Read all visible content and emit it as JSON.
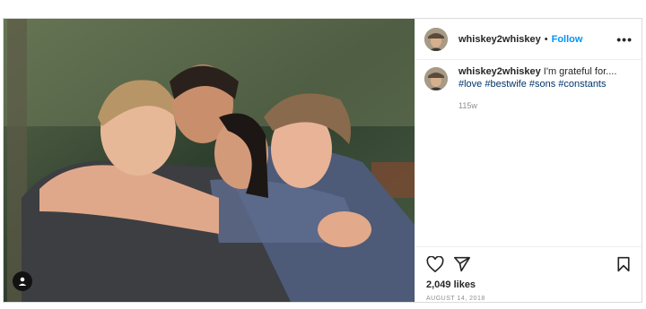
{
  "post": {
    "username": "whiskey2whiskey",
    "follow_separator": "•",
    "follow_label": "Follow",
    "more_label": "•••",
    "caption_username": "whiskey2whiskey",
    "caption_text": "I'm grateful for....",
    "hashtags": "#love #bestwife #sons #constants",
    "caption_time": "115w",
    "likes": "2,049 likes",
    "date": "AUGUST 14, 2018"
  },
  "icons": {
    "like": "heart-icon",
    "share": "share-icon",
    "save": "bookmark-icon",
    "tag": "person-tag-icon"
  },
  "colors": {
    "follow": "#0095f6",
    "hashtag": "#00376b",
    "muted": "#8e8e8e"
  }
}
